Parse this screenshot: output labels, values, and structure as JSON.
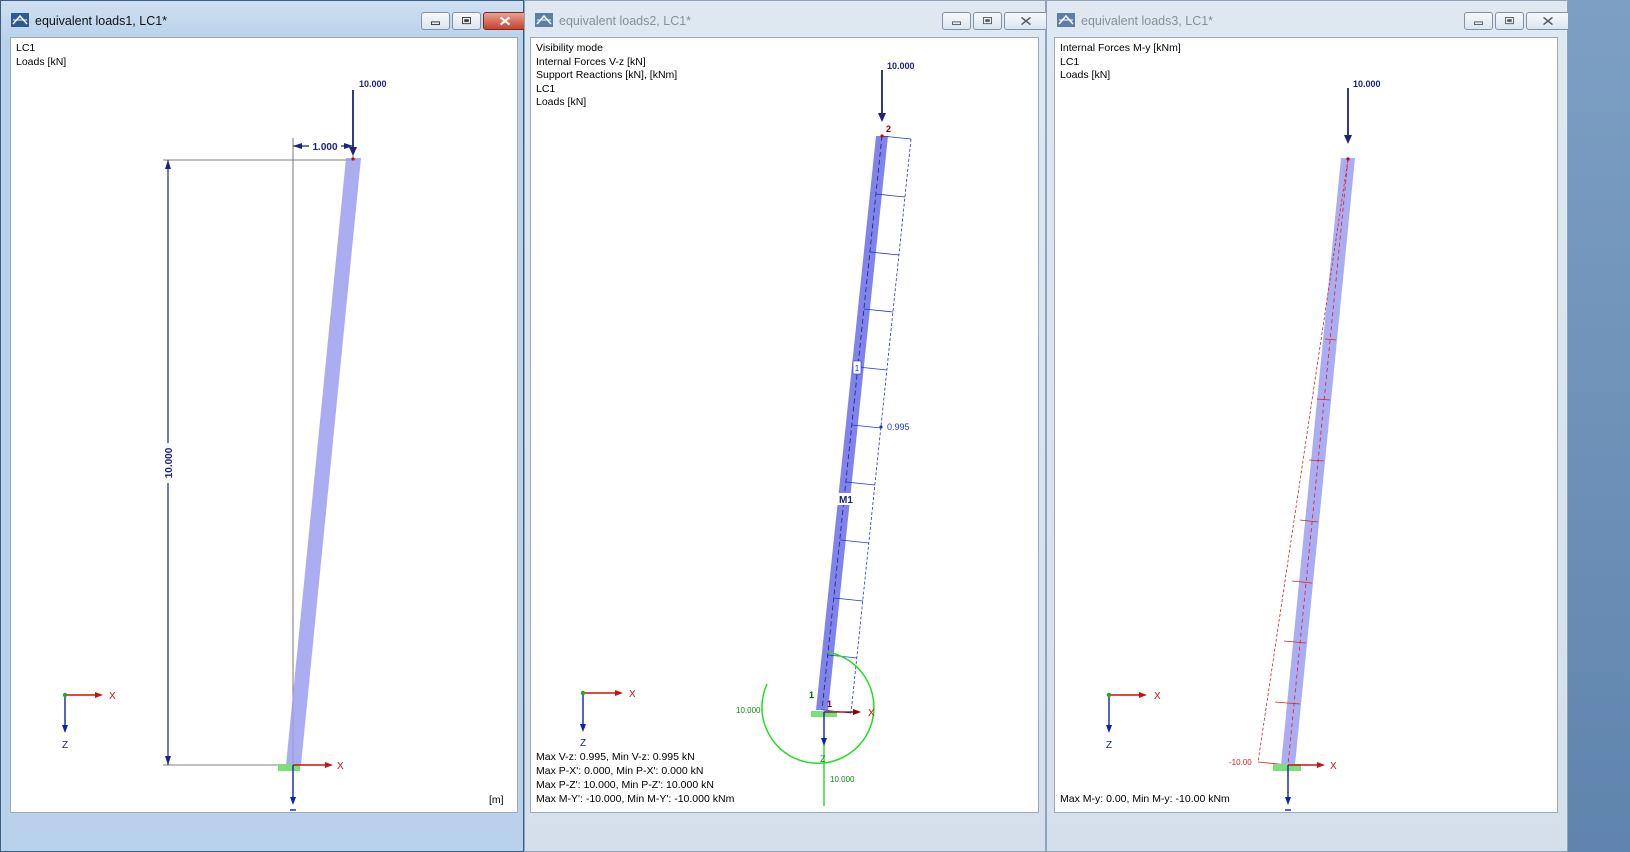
{
  "windows": [
    {
      "title": "equivalent loads1, LC1*",
      "info_lines": [
        "LC1",
        "Loads [kN]"
      ],
      "load_label": "10.000",
      "dim_horizontal": "1.000",
      "dim_vertical": "10.000",
      "unit_label": "[m]",
      "axis_x": "X",
      "axis_z": "Z",
      "support_axis_x": "X"
    },
    {
      "title": "equivalent loads2, LC1*",
      "info_lines": [
        "Visibility mode",
        "Internal Forces V-z [kN]",
        "Support Reactions [kN], [kNm]",
        "LC1",
        "Loads [kN]"
      ],
      "load_label": "10.000",
      "node_top": "2",
      "node_bottom": "1",
      "node_bottom_support": "1",
      "member_label": "M1",
      "member_tag": "1",
      "vz_value": "0.995",
      "reaction_moment_label": "10.000",
      "reaction_force_label": "10.000",
      "reaction_z_label": "Z",
      "axis_x": "X",
      "axis_z": "Z",
      "support_axis_x": "X",
      "stats_lines": [
        "Max V-z: 0.995, Min V-z: 0.995 kN",
        "Max P-X': 0.000, Min P-X': 0.000 kN",
        "Max P-Z': 10.000, Min P-Z': 10.000 kN",
        "Max M-Y': -10.000, Min M-Y': -10.000 kNm"
      ]
    },
    {
      "title": "equivalent loads3, LC1*",
      "info_lines": [
        "Internal Forces M-y [kNm]",
        "LC1",
        "Loads [kN]"
      ],
      "load_label": "10.000",
      "my_value": "-10.00",
      "axis_x": "X",
      "axis_z": "Z",
      "support_axis_x": "X",
      "stats_lines": [
        "Max M-y: 0.00, Min M-y: -10.00 kNm"
      ]
    }
  ],
  "colors": {
    "member": "#9c9ff0",
    "load_arrow": "#1a237e",
    "shear": "#2233dd",
    "moment": "#e02020",
    "reaction": "#22dd22",
    "axis_x": "#cc1111",
    "axis_z": "#1122aa"
  }
}
